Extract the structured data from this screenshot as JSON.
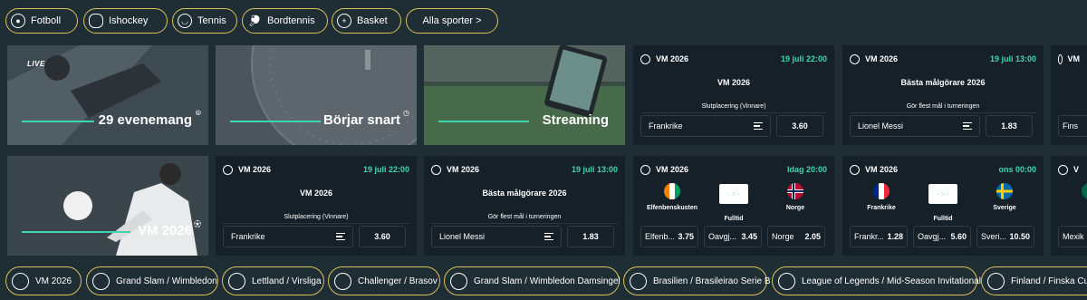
{
  "top_tabs": [
    {
      "label": "Fotboll",
      "icon": "football-icon"
    },
    {
      "label": "Ishockey",
      "icon": "hockey-puck-icon"
    },
    {
      "label": "Tennis",
      "icon": "tennis-ball-icon"
    },
    {
      "label": "Bordtennis",
      "icon": "table-tennis-icon"
    },
    {
      "label": "Basket",
      "icon": "basketball-icon"
    },
    {
      "label": "Alla sporter >",
      "icon": ""
    }
  ],
  "promos": {
    "live": {
      "badge": "LIVE",
      "label": "29 evenemang"
    },
    "soon": {
      "label": "Börjar snart"
    },
    "streaming": {
      "label": "Streaming"
    },
    "vm": {
      "label": "VM 2026"
    }
  },
  "cards": {
    "r1c4": {
      "league": "VM 2026",
      "date": "19 juli 22:00",
      "title": "VM 2026",
      "market": "Slutplacering (Vinnare)",
      "selection": "Frankrike",
      "odds": "3.60"
    },
    "r1c5": {
      "league": "VM 2026",
      "date": "19 juli 13:00",
      "title": "Bästa målgörare 2026",
      "market": "Gör flest mål i turneringen",
      "selection": "Lionel Messi",
      "odds": "1.83"
    },
    "r1c6": {
      "league": "VM",
      "selection": "Fins"
    },
    "r2c2": {
      "league": "VM 2026",
      "date": "19 juli 22:00",
      "title": "VM 2026",
      "market": "Slutplacering (Vinnare)",
      "selection": "Frankrike",
      "odds": "3.60"
    },
    "r2c3": {
      "league": "VM 2026",
      "date": "19 juli 13:00",
      "title": "Bästa målgörare 2026",
      "market": "Gör flest mål i turneringen",
      "selection": "Lionel Messi",
      "odds": "1.83"
    },
    "r2c4": {
      "league": "VM 2026",
      "date": "Idag 20:00",
      "home": "Elfenbenskusten",
      "away": "Norge",
      "market": "Fulltid",
      "odds": [
        {
          "n": "Elfenb...",
          "v": "3.75"
        },
        {
          "n": "Oavgj...",
          "v": "3.45"
        },
        {
          "n": "Norge",
          "v": "2.05"
        }
      ]
    },
    "r2c5": {
      "league": "VM 2026",
      "date": "ons 00:00",
      "home": "Frankrike",
      "away": "Sverige",
      "market": "Fulltid",
      "odds": [
        {
          "n": "Frankr...",
          "v": "1.28"
        },
        {
          "n": "Oavgj...",
          "v": "5.60"
        },
        {
          "n": "Sveri...",
          "v": "10.50"
        }
      ]
    },
    "r2c6": {
      "league": "V",
      "selection": "Mexik"
    }
  },
  "bottom_tabs": [
    {
      "label": "VM 2026",
      "icon": "football-icon"
    },
    {
      "label": "Grand Slam / Wimbledon",
      "icon": "tennis-ball-icon"
    },
    {
      "label": "Lettland / Virsliga",
      "icon": "football-icon"
    },
    {
      "label": "Challenger / Brasov",
      "icon": "tennis-ball-icon"
    },
    {
      "label": "Grand Slam / Wimbledon Damsingel",
      "icon": "tennis-ball-icon"
    },
    {
      "label": "Brasilien / Brasileirao Serie B",
      "icon": "football-icon"
    },
    {
      "label": "League of Legends / Mid-Season Invitational",
      "icon": "esports-icon"
    },
    {
      "label": "Finland / Finska Cup",
      "icon": "football-icon"
    }
  ],
  "colors": {
    "accent": "#3ed6b0",
    "gold": "#d9c15a",
    "bg": "#1f2d35",
    "card": "#152028"
  }
}
